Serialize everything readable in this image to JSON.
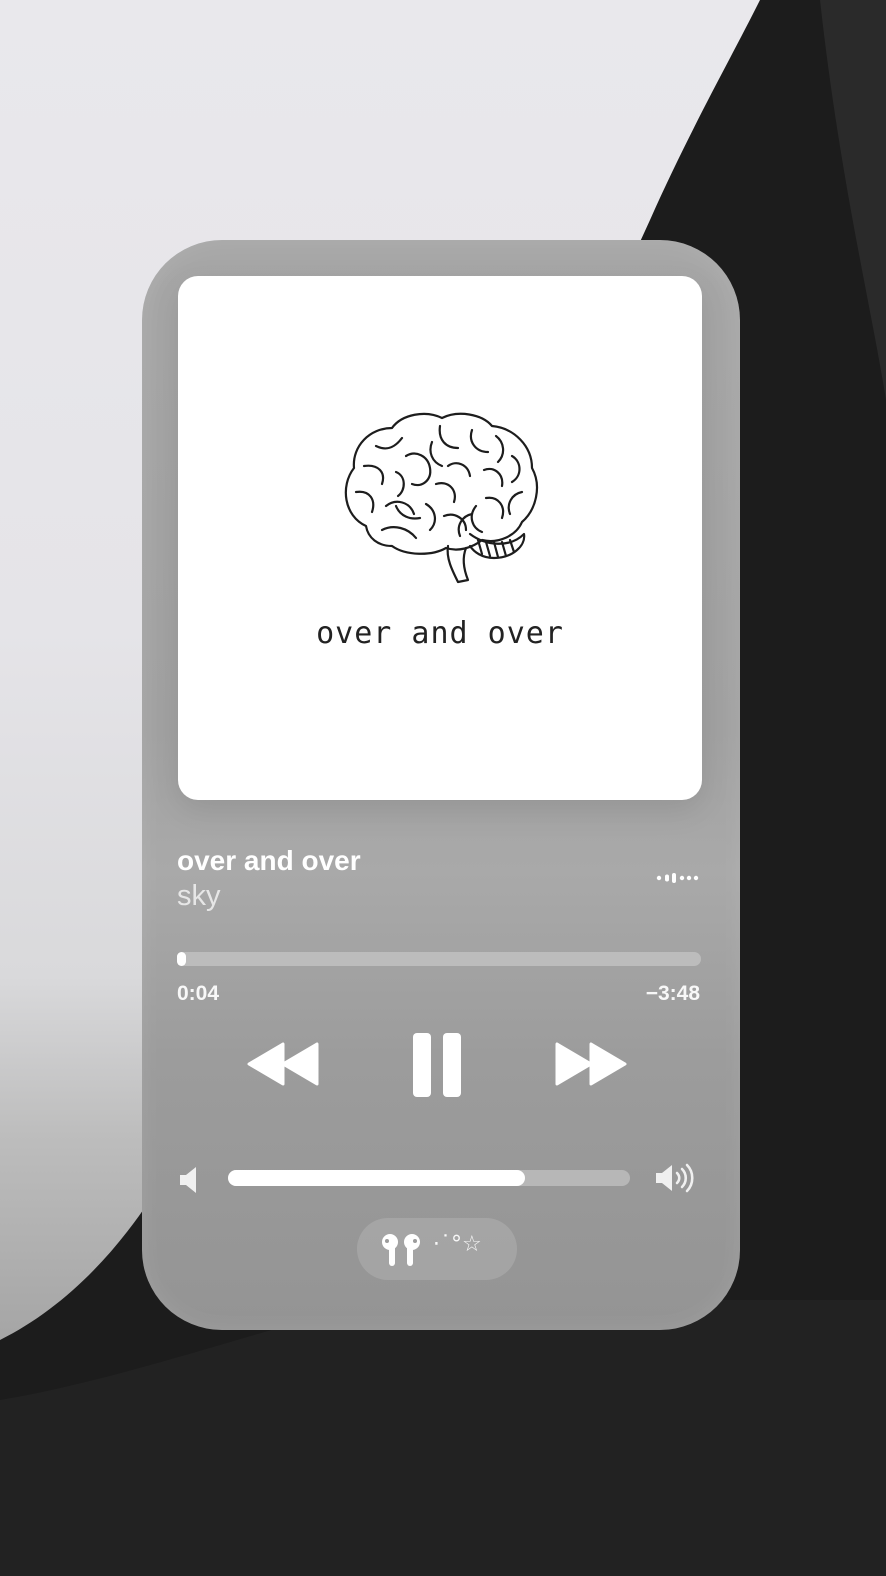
{
  "artwork": {
    "caption": "over and over"
  },
  "track": {
    "title": "over and over",
    "artist": "sky"
  },
  "progress": {
    "elapsed": "0:04",
    "remaining": "−3:48",
    "fraction": 0.017
  },
  "volume": {
    "level": 0.74
  },
  "route": {
    "label": "⋅˙°☆"
  },
  "colors": {
    "card": "#a5a5a5",
    "artwork_bg": "#ffffff",
    "accent": "#ffffff"
  }
}
